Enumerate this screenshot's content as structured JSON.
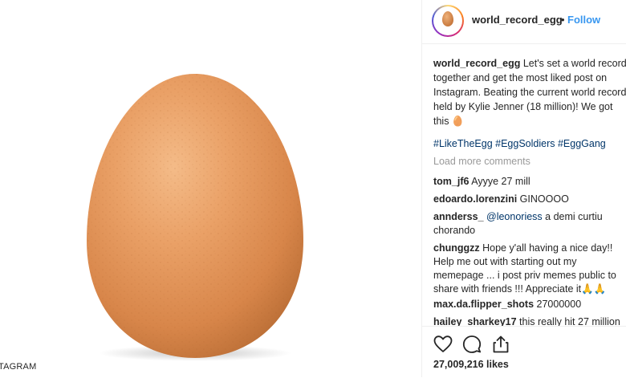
{
  "photo": {
    "watermark": "TAGRAM",
    "egg_color": "#e9a06a",
    "egg_shadow": "#b96d35"
  },
  "header": {
    "username": "world_record_egg",
    "separator": "•",
    "follow_label": "Follow",
    "avatar_icon": "egg-avatar"
  },
  "caption": {
    "username": "world_record_egg",
    "lines": [
      "Let's set a world record",
      "together and get the most liked post on",
      "Instagram. Beating the current world record",
      "held by Kylie Jenner (18 million)! We got",
      "this 🥚"
    ],
    "hashtags": "#LikeTheEgg #EggSoldiers #EggGang"
  },
  "load_more_label": "Load more comments",
  "comments": [
    {
      "user": "tom_jf6",
      "text": "Ayyye 27 mill"
    },
    {
      "user": "edoardo.lorenzini",
      "text": "GINOOOO"
    },
    {
      "user": "annderss_",
      "mention": "@leonoriess",
      "text": "a demi curtiu",
      "text2": "chorando"
    },
    {
      "user": "chunggzz",
      "text": "Hope y'all having a nice day!!",
      "text2": "Help me out with starting out my",
      "text3": "memepage ... i post priv memes public to",
      "text4": "share with friends !!! Appreciate it🙏🙏"
    },
    {
      "user": "max.da.flipper_shots",
      "text": "27000000"
    },
    {
      "user": "hailey_sharkey17",
      "text": "this really hit 27 million"
    }
  ],
  "actions": {
    "like_icon": "heart-icon",
    "comment_icon": "comment-icon",
    "share_icon": "share-icon",
    "likes_text": "27,009,216 likes"
  },
  "colors": {
    "link": "#3897f0",
    "hashtag": "#003569",
    "muted": "#999999",
    "text": "#262626"
  }
}
